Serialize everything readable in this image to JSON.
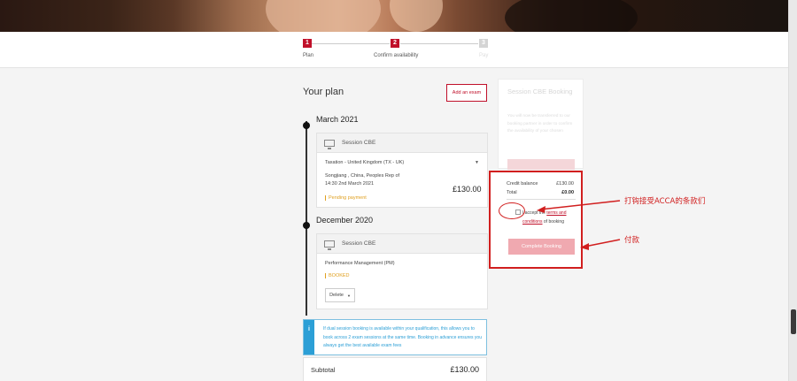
{
  "stepper": {
    "steps": [
      {
        "number": "1",
        "label": "Plan",
        "color": "#c0102a"
      },
      {
        "number": "2",
        "label": "Confirm availability",
        "color": "#c0102a"
      },
      {
        "number": "3",
        "label": "Pay",
        "color": "#d4d4d4"
      }
    ]
  },
  "plan": {
    "title": "Your plan",
    "add_exam_label": "Add an exam",
    "groups": [
      {
        "month": "March 2021",
        "card_type": "Session CBE",
        "exam": "Taxation - United Kingdom (TX - UK)",
        "location_line1": "Songjiang , China, Peoples Rep of",
        "location_line2": "14:30 2nd March 2021",
        "status": "Pending payment",
        "price": "£130.00"
      },
      {
        "month": "December 2020",
        "card_type": "Session CBE",
        "exam": "Performance Management (PM)",
        "status": "BOOKED",
        "delete_label": "Delete"
      }
    ],
    "info_icon": "i",
    "info_text": "If dual session booking is available within your qualification, this allows you to book across 2 exam sessions at the same time. Booking in advance ensures you always get the best available exam fees",
    "subtotal_label": "Subtotal",
    "subtotal_value": "£130.00"
  },
  "side": {
    "title": "Session CBE Booking",
    "description": "You will now be transferred to our booking partner in order to confirm the availability of your chosen"
  },
  "booking": {
    "credit_label": "Credit balance",
    "credit_value": "£130.00",
    "total_label": "Total",
    "total_value": "£0.00",
    "accept_text": "I accept the",
    "terms_text": "terms and conditions",
    "of_booking": "of booking",
    "complete_label": "Complete Booking"
  },
  "annotations": {
    "accept_note": "打钩接受ACCA的条款们",
    "pay_note": "付款"
  },
  "colors": {
    "brand_red": "#c0102a",
    "info_blue": "#2c9fd6",
    "pending_orange": "#e0a020",
    "annotation_red": "#d11f1f"
  }
}
